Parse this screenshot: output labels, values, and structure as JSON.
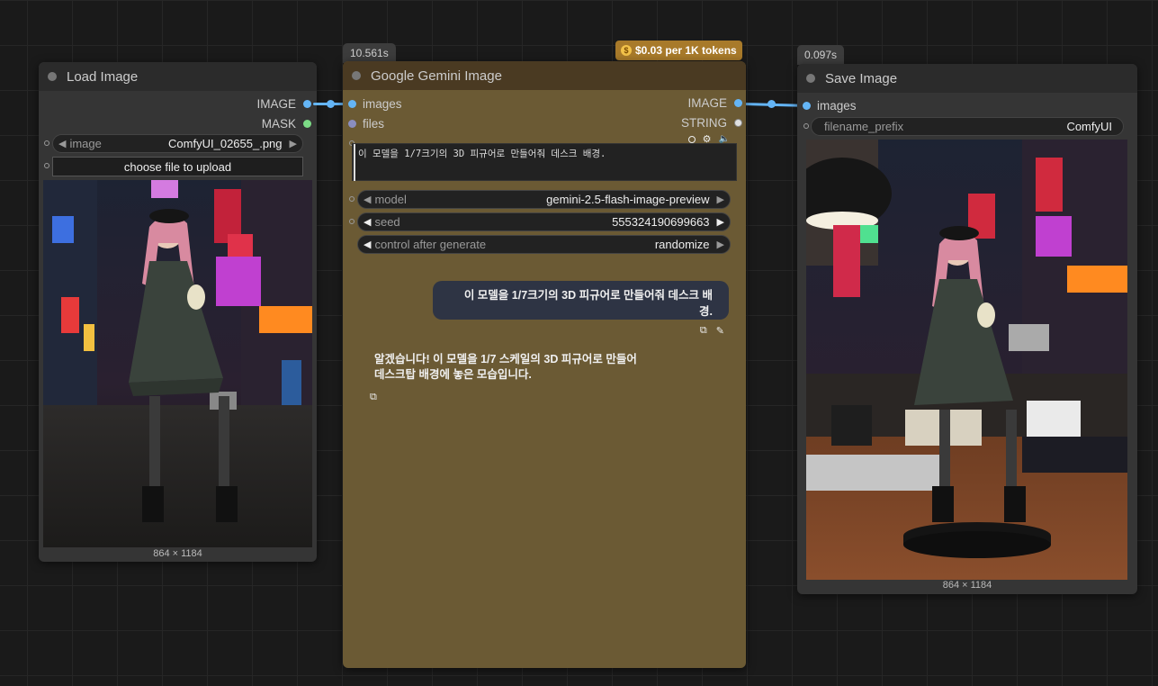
{
  "load_image": {
    "title": "Load Image",
    "outputs": [
      "IMAGE",
      "MASK"
    ],
    "image_widget": {
      "label": "image",
      "value": "ComfyUI_02655_.png"
    },
    "upload_button": "choose file to upload",
    "dimensions": "864 × 1184"
  },
  "gemini": {
    "title": "Google Gemini Image",
    "timing": "10.561s",
    "price_badge": "$0.03 per 1K tokens",
    "inputs": [
      "images",
      "files"
    ],
    "outputs": [
      "IMAGE",
      "STRING"
    ],
    "prompt": "이 모델을 1/7크기의 3D 피규어로 만들어줘 데스크 배경.",
    "widgets": [
      {
        "label": "model",
        "value": "gemini-2.5-flash-image-preview"
      },
      {
        "label": "seed",
        "value": "555324190699663"
      },
      {
        "label": "control after generate",
        "value": "randomize"
      }
    ],
    "chat": {
      "user_message": "이 모델을 1/7크기의 3D 피규어로 만들어줘 데스크 배경.",
      "assistant_message": "알겠습니다! 이 모델을 1/7 스케일의 3D 피규어로 만들어 데스크탑 배경에 놓은 모습입니다."
    }
  },
  "save_image": {
    "title": "Save Image",
    "timing": "0.097s",
    "inputs": [
      "images"
    ],
    "filename_widget": {
      "label": "filename_prefix",
      "value": "ComfyUI"
    },
    "dimensions": "864 × 1184"
  },
  "colors": {
    "canvas": "#1a1a1a",
    "node_body": "#353535",
    "node_header": "#2b2b2b",
    "gemini_body": "#6b5a34",
    "gemini_header": "#4a3a22",
    "badge": "#a87a2a",
    "link_blue": "#64b5f6",
    "chat_bubble": "#2e3444"
  }
}
